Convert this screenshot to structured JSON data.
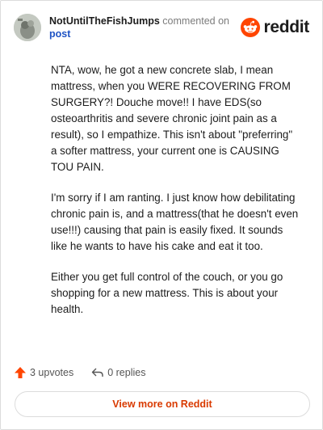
{
  "header": {
    "username": "NotUntilTheFishJumps",
    "action_text": "commented on",
    "post_link": "post",
    "brand_name": "reddit",
    "brand_color": "#ff4500",
    "avatar_icon": "avatar-icon",
    "logo_icon": "reddit-snoo-icon"
  },
  "comment": {
    "paragraphs": [
      "NTA, wow, he got a new concrete slab, I mean mattress, when you WERE RECOVERING FROM SURGERY?! Douche move!! I have EDS(so osteoarthritis and severe chronic joint pain as a result), so I empathize. This isn't about \"preferring\" a softer mattress, your current one is CAUSING TOU PAIN.",
      "I'm sorry if I am ranting. I just know how debilitating chronic pain is, and a mattress(that he doesn't even use!!!) causing that pain is easily fixed. It sounds like he wants to have his cake and eat it too.",
      "Either you get full control of the couch, or you go shopping for a new mattress. This is about your health."
    ]
  },
  "actions": {
    "upvotes": "3 upvotes",
    "replies": "0 replies",
    "upvote_icon": "upvote-arrow-icon",
    "reply_icon": "reply-arrow-icon",
    "upvote_color": "#ff4500"
  },
  "footer": {
    "view_more_label": "View more on Reddit",
    "link_color": "#d93a00"
  }
}
